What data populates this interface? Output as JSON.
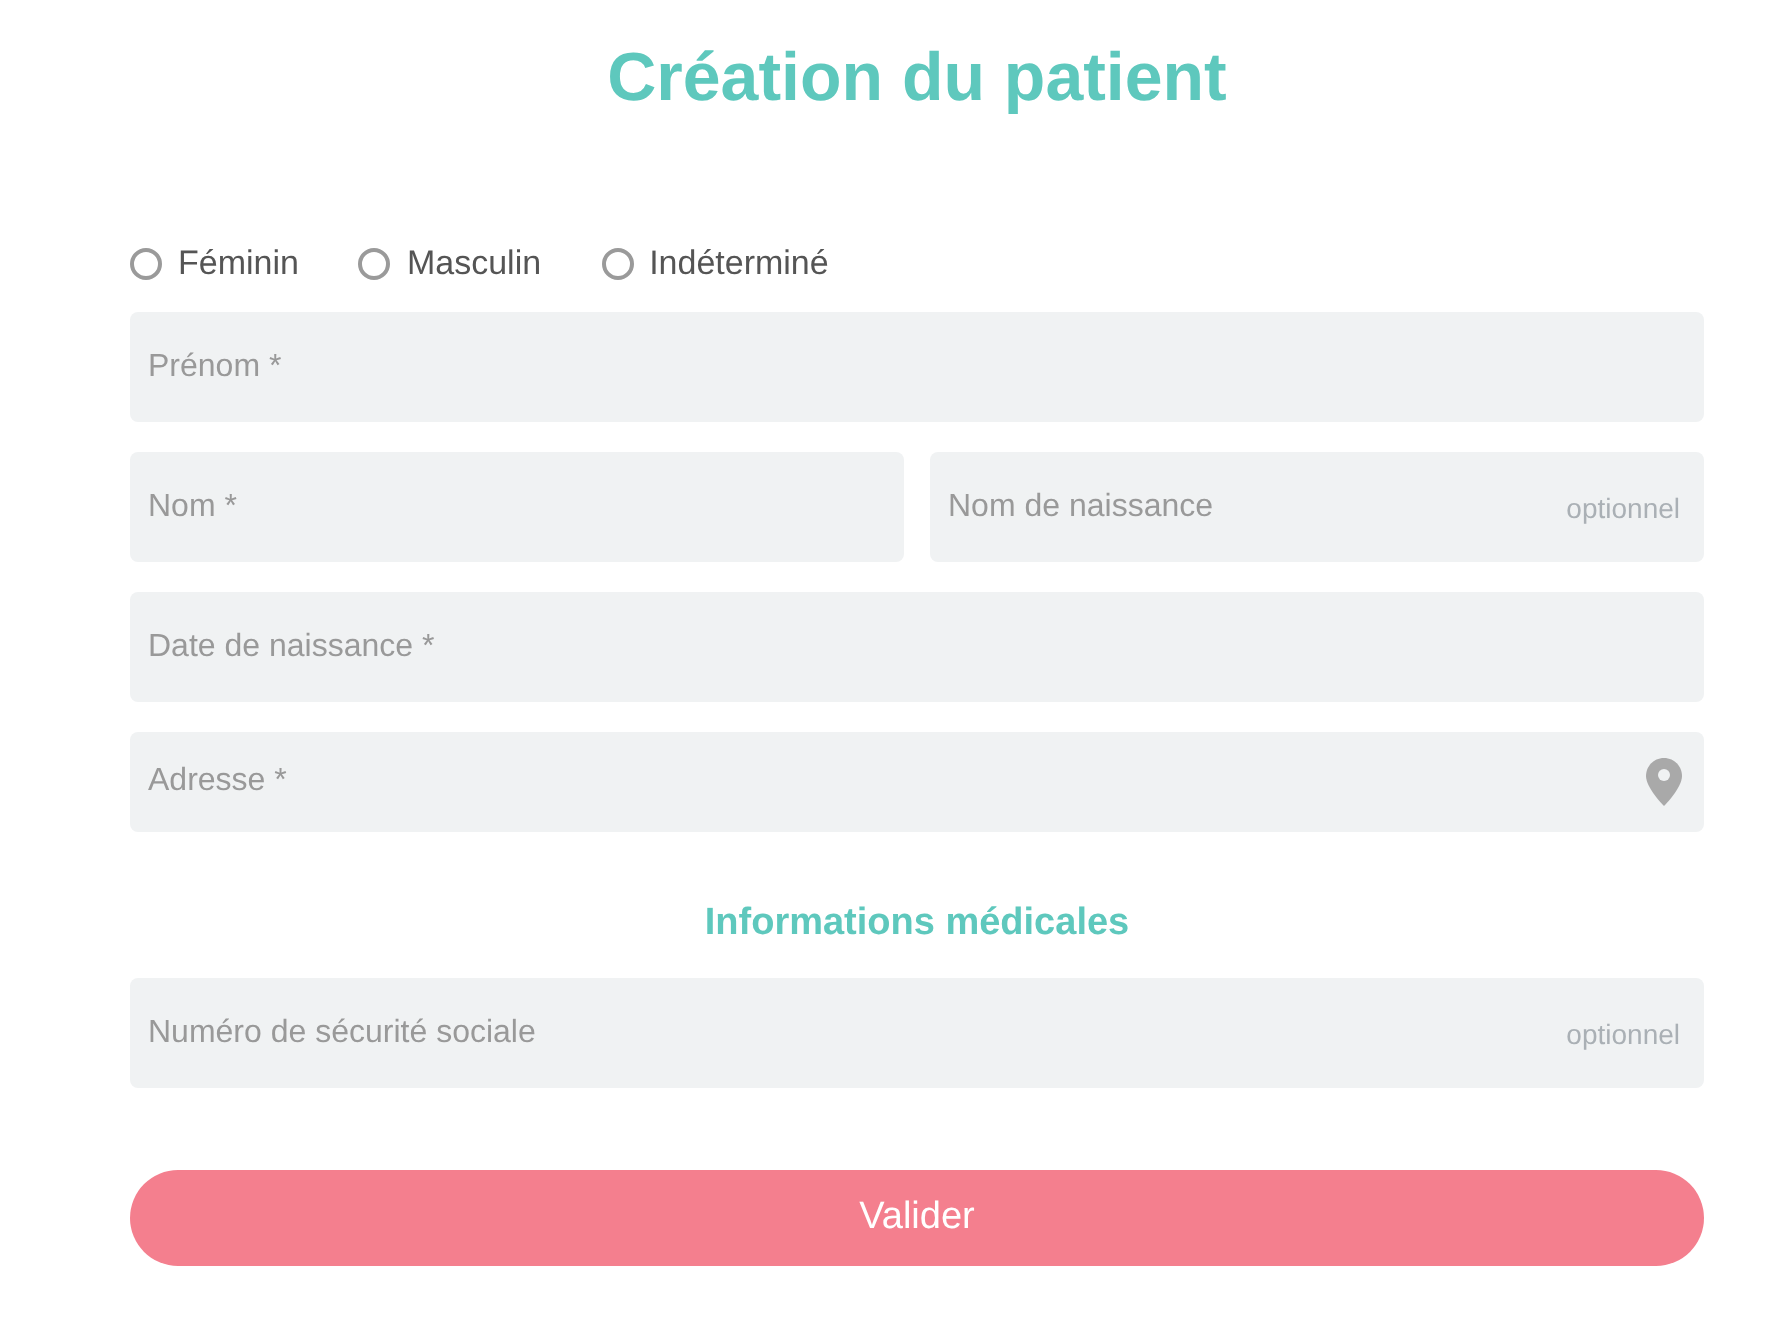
{
  "title": "Création du patient",
  "gender": [
    {
      "label": "Féminin",
      "selected": false
    },
    {
      "label": "Masculin",
      "selected": false
    },
    {
      "label": "Indéterminé",
      "selected": false
    }
  ],
  "identity_rows": [
    [
      {
        "placeholder": "Prénom *",
        "kind": "text"
      }
    ],
    [
      {
        "placeholder": "Nom *",
        "kind": "text"
      },
      {
        "placeholder": "Nom de naissance",
        "hint": "optionnel",
        "kind": "text"
      }
    ],
    [
      {
        "placeholder": "Date de naissance *",
        "kind": "text"
      }
    ],
    [
      {
        "placeholder": "Adresse *",
        "kind": "address"
      }
    ]
  ],
  "medical": {
    "heading": "Informations médicales",
    "rows": [
      [
        {
          "placeholder": "Numéro de sécurité sociale",
          "hint": "optionnel",
          "kind": "text"
        }
      ]
    ]
  },
  "submit": "Valider"
}
